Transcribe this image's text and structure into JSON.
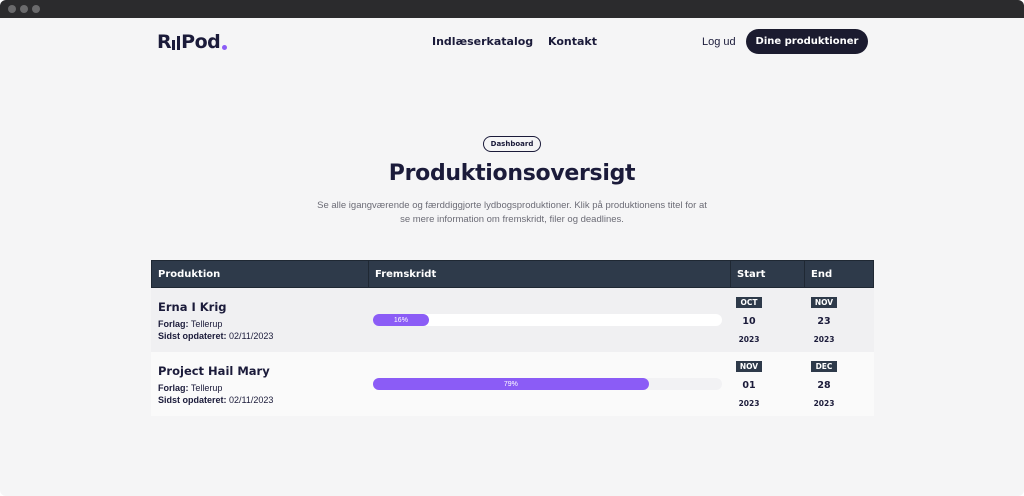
{
  "brand": {
    "pre": "R",
    "post": "Pod"
  },
  "nav": {
    "catalog": "Indlæserkatalog",
    "contact": "Kontakt"
  },
  "auth": {
    "login": "Log ud",
    "cta": "Dine produktioner"
  },
  "hero": {
    "chip": "Dashboard",
    "title": "Produktionsoversigt",
    "subtitle": "Se alle igangværende og færddiggjorte lydbogsproduktioner. Klik på produktionens titel for at se mere information om fremskridt, filer og deadlines."
  },
  "table": {
    "headers": [
      "Produktion",
      "Fremskridt",
      "Start",
      "End"
    ],
    "rows": [
      {
        "title": "Erna I Krig",
        "publisher_label": "Forlag:",
        "publisher": "Tellerup",
        "updated_label": "Sidst opdateret:",
        "updated": "02/11/2023",
        "progress": 16,
        "progress_text": "16%",
        "start": {
          "month": "OCT",
          "day": "10",
          "year": "2023"
        },
        "end": {
          "month": "NOV",
          "day": "23",
          "year": "2023"
        }
      },
      {
        "title": "Project Hail Mary",
        "publisher_label": "Forlag:",
        "publisher": "Tellerup",
        "updated_label": "Sidst opdateret:",
        "updated": "02/11/2023",
        "progress": 79,
        "progress_text": "79%",
        "start": {
          "month": "NOV",
          "day": "01",
          "year": "2023"
        },
        "end": {
          "month": "DEC",
          "day": "28",
          "year": "2023"
        }
      }
    ]
  },
  "colors": {
    "accent": "#8b5cf6",
    "navy": "#1b1b3a",
    "header": "#2e3a4a"
  }
}
